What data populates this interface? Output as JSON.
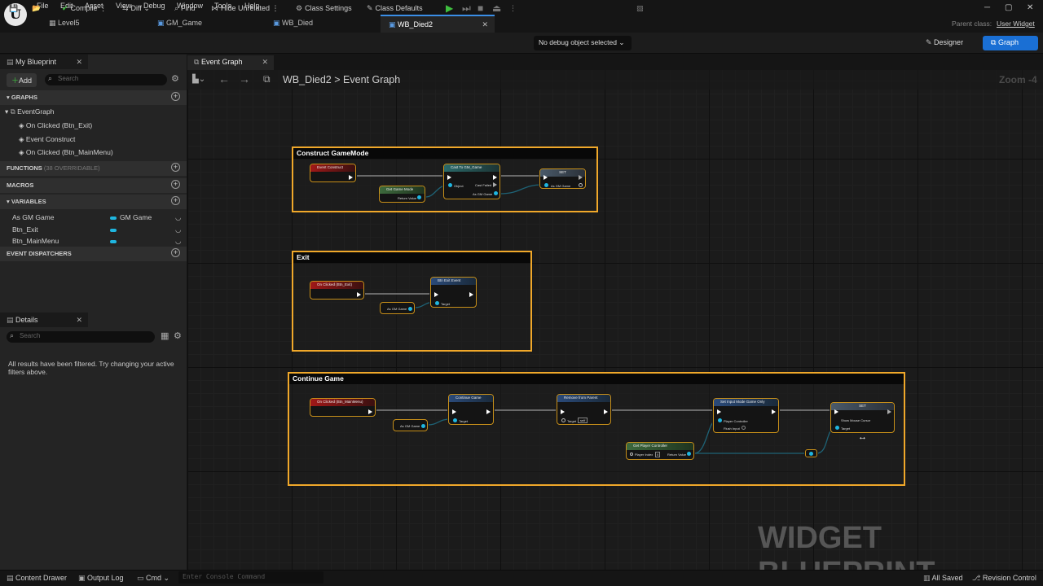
{
  "menu": [
    "File",
    "Edit",
    "Asset",
    "View",
    "Debug",
    "Window",
    "Tools",
    "Help"
  ],
  "doc_tabs": [
    {
      "label": "Level5",
      "active": false
    },
    {
      "label": "GM_Game",
      "active": false
    },
    {
      "label": "WB_Died",
      "active": false
    },
    {
      "label": "WB_Died2",
      "active": true
    }
  ],
  "parent_class": {
    "label": "Parent class:",
    "value": "User Widget"
  },
  "toolbar": {
    "compile": "Compile",
    "diff": "Diff",
    "find": "Find",
    "hide_unrelated": "Hide Unrelated",
    "class_settings": "Class Settings",
    "class_defaults": "Class Defaults",
    "debug_object": "No debug object selected",
    "designer": "Designer",
    "graph": "Graph"
  },
  "my_blueprint": {
    "tab": "My Blueprint",
    "add": "Add",
    "search_placeholder": "Search",
    "graphs_header": "GRAPHS",
    "event_graph": "EventGraph",
    "graph_items": [
      "On Clicked (Btn_Exit)",
      "Event Construct",
      "On Clicked (Btn_MainMenu)"
    ],
    "functions_header": "FUNCTIONS",
    "functions_overridable": "(38 OVERRIDABLE)",
    "macros_header": "MACROS",
    "variables_header": "VARIABLES",
    "variables": [
      {
        "name": "As GM Game",
        "type": "GM Game"
      },
      {
        "name": "Btn_Exit",
        "type": ""
      },
      {
        "name": "Btn_MainMenu",
        "type": ""
      }
    ],
    "dispatchers_header": "EVENT DISPATCHERS"
  },
  "details": {
    "tab": "Details",
    "search_placeholder": "Search",
    "message": "All results have been filtered. Try changing your active filters above."
  },
  "graph": {
    "tab": "Event Graph",
    "breadcrumb_root": "WB_Died2",
    "breadcrumb_sep": ">",
    "breadcrumb_leaf": "Event Graph",
    "zoom": "Zoom -4",
    "watermark": "WIDGET BLUEPRINT",
    "comments": [
      {
        "title": "Construct GameMode"
      },
      {
        "title": "Exit"
      },
      {
        "title": "Continue Game"
      }
    ],
    "nodes": {
      "event_construct": "Event Construct",
      "get_game_mode": "Get Game Mode",
      "return_value": "Return Value",
      "cast_to_gm": "Cast To GM_Game",
      "object": "Object",
      "cast_failed": "Cast Failed",
      "as_gm_game": "As GM Game",
      "set": "SET",
      "on_clicked_exit": "On Clicked (Btn_Exit)",
      "btn_exit_event": "Btn Exit Event",
      "target": "Target",
      "as_gm_game_ref": "As GM Game",
      "on_clicked_mainmenu": "On Clicked (Btn_MainMenu)",
      "continue_game": "Continue Game",
      "remove_from_parent": "Remove from Parent",
      "self": "self",
      "set_input_mode": "Set Input Mode Game Only",
      "player_controller": "Player Controller",
      "flush_input": "Flush Input",
      "get_player_controller": "Get Player Controller",
      "player_index": "Player Index",
      "player_index_value": "0",
      "show_mouse_cursor": "Show Mouse Cursor"
    }
  },
  "bottom": {
    "content_drawer": "Content Drawer",
    "output_log": "Output Log",
    "cmd": "Cmd",
    "console_placeholder": "Enter Console Command",
    "all_saved": "All Saved",
    "revision_control": "Revision Control"
  },
  "colors": {
    "accent": "#1a6fd4",
    "comment_border": "#f0a82a",
    "object_pin": "#1fb6e0",
    "play": "#3fbf3f"
  }
}
